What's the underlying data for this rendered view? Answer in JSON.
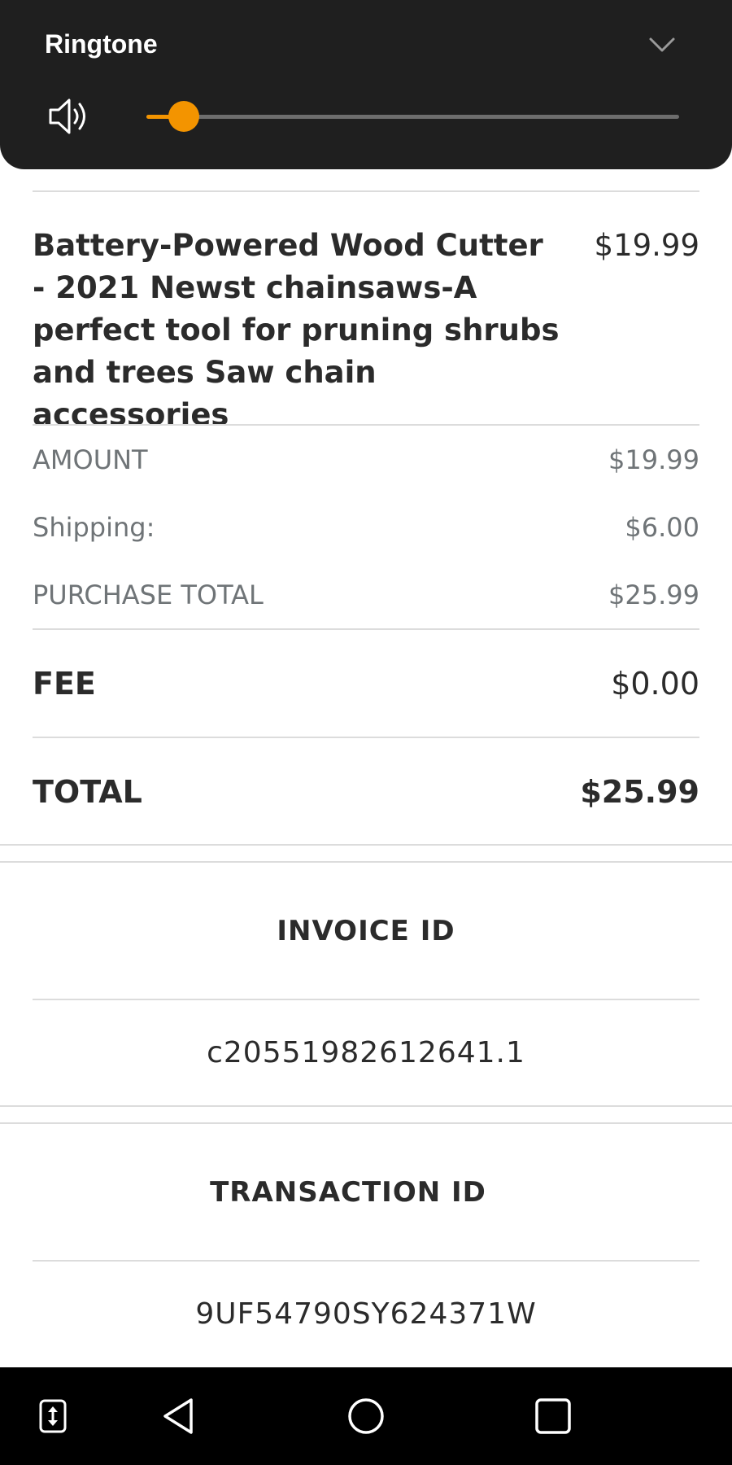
{
  "volume_panel": {
    "title": "Ringtone",
    "level": 0.07
  },
  "item": {
    "title": "Battery-Powered Wood Cutter - 2021 Newst chainsaws-A perfect tool for pruning shrubs and trees Saw chain accessories",
    "price": "$19.99"
  },
  "summary": {
    "amount_label": "AMOUNT",
    "amount_value": "$19.99",
    "shipping_label": "Shipping:",
    "shipping_value": "$6.00",
    "purchase_total_label": "PURCHASE TOTAL",
    "purchase_total_value": "$25.99",
    "fee_label": "FEE",
    "fee_value": "$0.00",
    "total_label": "TOTAL",
    "total_value": "$25.99"
  },
  "invoice": {
    "heading": "INVOICE ID",
    "value": "c20551982612641.1"
  },
  "transaction": {
    "heading": "TRANSACTION ID",
    "value": "9UF54790SY624371W"
  },
  "colors": {
    "accent": "#f39400",
    "panel_bg": "#1f1f1f",
    "nav_bg": "#000000"
  },
  "nav_icons": [
    "screen-switch-icon",
    "back-icon",
    "home-icon",
    "recents-icon"
  ]
}
